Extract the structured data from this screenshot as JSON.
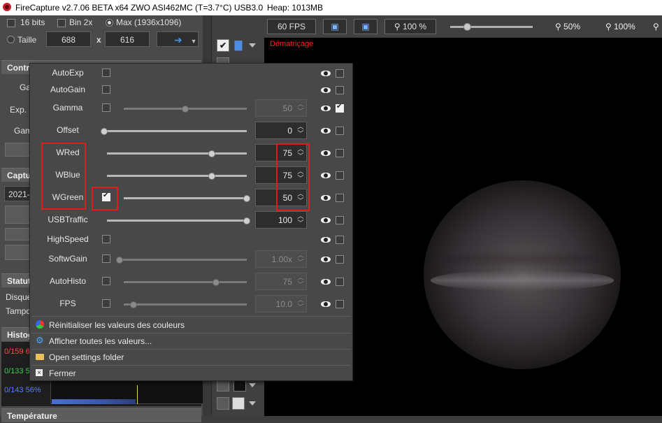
{
  "titlebar": {
    "app": "FireCapture v2.7.06 BETA x64",
    "camera": "ZWO ASI462MC (T=3.7°C) USB3.0",
    "heap": "Heap: 1013MB"
  },
  "left": {
    "opt_16bits": "16 bits",
    "opt_bin2x": "Bin 2x",
    "opt_max": "Max (1936x1096)",
    "taille_label": "Taille",
    "width": "688",
    "x_sep": "x",
    "height": "616",
    "controls_header": "Contrô",
    "ctrl_labels": [
      "Ga",
      "Exp. (",
      "Gam"
    ],
    "capture_header": "Captu",
    "capture_value": "2021-",
    "status_header": "Statut",
    "status_labels": [
      "Disque",
      "Tampo"
    ],
    "histo_header": "Histog",
    "histo_rows": [
      {
        "text": "0/159 6",
        "color": "#ff4a4a"
      },
      {
        "text": "0/133 5",
        "color": "#3fd04a"
      },
      {
        "text": "0/143 56%",
        "color": "#5a7cff"
      }
    ],
    "temp_header": "Température"
  },
  "toolbar": {
    "fps": "60 FPS",
    "zoom_pct": "100 %",
    "zoom50": "50%",
    "zoom100": "100%"
  },
  "preview": {
    "debayer_label": "Dématriçage"
  },
  "popup": {
    "params": [
      {
        "name": "AutoExp",
        "checked": false,
        "slider": null,
        "value": null
      },
      {
        "name": "AutoGain",
        "checked": false,
        "slider": null,
        "value": null
      },
      {
        "name": "Gamma",
        "checked": false,
        "slider": 0.5,
        "value": "50",
        "dim": true,
        "visible": true
      },
      {
        "name": "Offset",
        "checked": null,
        "slider": 0.0,
        "value": "0",
        "dim": false
      },
      {
        "name": "WRed",
        "checked": null,
        "slider": 0.75,
        "value": "75",
        "dim": false
      },
      {
        "name": "WBlue",
        "checked": null,
        "slider": 0.75,
        "value": "75",
        "dim": false
      },
      {
        "name": "WGreen",
        "checked": true,
        "slider": 1.0,
        "value": "50",
        "dim": false
      },
      {
        "name": "USBTraffic",
        "checked": null,
        "slider": 1.0,
        "value": "100",
        "dim": false
      },
      {
        "name": "HighSpeed",
        "checked": false,
        "slider": null,
        "value": null
      },
      {
        "name": "SoftwGain",
        "checked": false,
        "slider": 0.0,
        "value": "1.00x",
        "dim": true
      },
      {
        "name": "AutoHisto",
        "checked": false,
        "slider": 0.75,
        "value": "75",
        "dim": true
      },
      {
        "name": "FPS",
        "checked": false,
        "slider": 0.08,
        "value": "10.0",
        "dim": true
      }
    ],
    "menu": [
      {
        "label": "Réinitialiser les valeurs des couleurs",
        "icon": "color-reset-icon"
      },
      {
        "label": "Afficher toutes les valeurs...",
        "icon": "gear-icon"
      },
      {
        "label": "Open settings folder",
        "icon": "folder-icon"
      },
      {
        "label": "Fermer",
        "icon": "close-icon"
      }
    ]
  }
}
